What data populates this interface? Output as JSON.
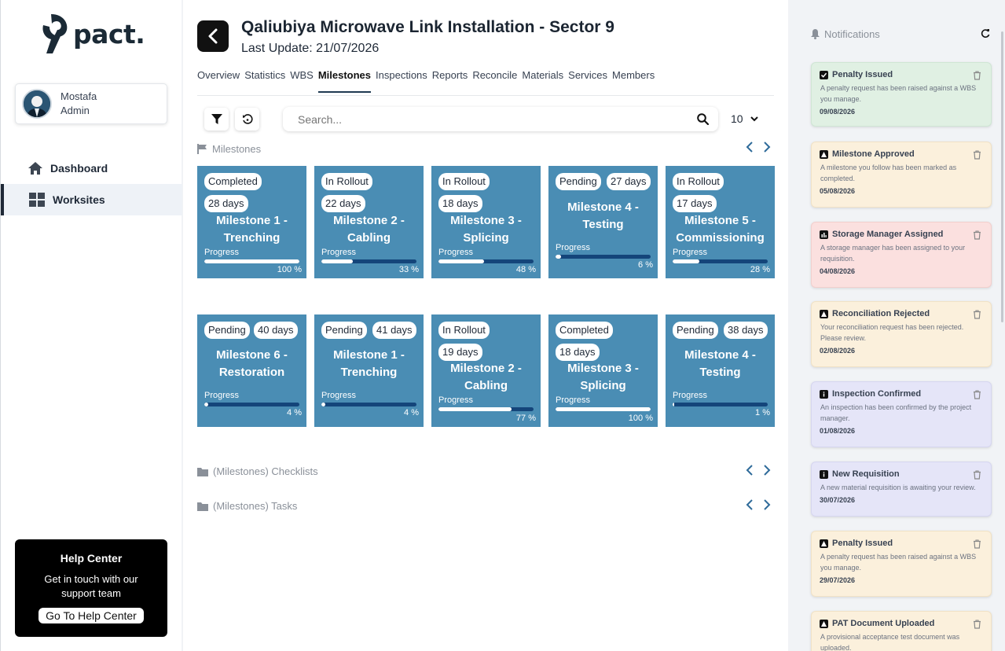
{
  "brand": {
    "name": "pact."
  },
  "user": {
    "name": "Mostafa",
    "role": "Admin"
  },
  "nav": [
    {
      "label": "Dashboard",
      "icon": "home-icon",
      "active": false
    },
    {
      "label": "Worksites",
      "icon": "grid-icon",
      "active": true
    }
  ],
  "help": {
    "title": "Help Center",
    "text": "Get in touch with our support team",
    "button": "Go To Help Center"
  },
  "header": {
    "title": "Qaliubiya Microwave Link Installation - Sector 9",
    "last_update": "Last Update: 21/07/2026"
  },
  "tabs": [
    "Overview",
    "Statistics",
    "WBS",
    "Milestones",
    "Inspections",
    "Reports",
    "Reconcile",
    "Materials",
    "Services",
    "Members"
  ],
  "active_tab": "Milestones",
  "search": {
    "placeholder": "Search..."
  },
  "page_size": "10",
  "sections": {
    "milestones": "Milestones",
    "checklists": "(Milestones) Checklists",
    "tasks": "(Milestones) Tasks"
  },
  "progress_label": "Progress",
  "colors": {
    "card": "#4a8db4",
    "bar_track": "#14457a",
    "accent": "#1f3a52"
  },
  "milestones": [
    {
      "status": "Completed",
      "days": "28 days",
      "title": "Milestone 1 - Trenching",
      "progress": 100,
      "pct": "100 %"
    },
    {
      "status": "In Rollout",
      "days": "22 days",
      "title": "Milestone 2 - Cabling",
      "progress": 33,
      "pct": "33 %"
    },
    {
      "status": "In Rollout",
      "days": "18 days",
      "title": "Milestone 3 - Splicing",
      "progress": 48,
      "pct": "48 %"
    },
    {
      "status": "Pending",
      "days": "27 days",
      "title": "Milestone 4 - Testing",
      "progress": 6,
      "pct": "6 %"
    },
    {
      "status": "In Rollout",
      "days": "17 days",
      "title": "Milestone 5 - Commissioning",
      "progress": 28,
      "pct": "28 %"
    },
    {
      "status": "Pending",
      "days": "40 days",
      "title": "Milestone 6 - Restoration",
      "progress": 4,
      "pct": "4 %"
    },
    {
      "status": "Pending",
      "days": "41 days",
      "title": "Milestone 1 - Trenching",
      "progress": 4,
      "pct": "4 %"
    },
    {
      "status": "In Rollout",
      "days": "19 days",
      "title": "Milestone 2 - Cabling",
      "progress": 77,
      "pct": "77 %"
    },
    {
      "status": "Completed",
      "days": "18 days",
      "title": "Milestone 3 - Splicing",
      "progress": 100,
      "pct": "100 %"
    },
    {
      "status": "Pending",
      "days": "38 days",
      "title": "Milestone 4 - Testing",
      "progress": 1,
      "pct": "1 %"
    }
  ],
  "notifications_title": "Notifications",
  "notifications": [
    {
      "title": "Penalty Issued",
      "icon": "check-icon",
      "body": "A penalty request has been raised against a WBS you manage.",
      "date": "09/08/2026",
      "color": "#e0f0e3",
      "border": "#cfe6d4"
    },
    {
      "title": "Milestone Approved",
      "icon": "warning-icon",
      "body": "A milestone you follow has been marked as completed.",
      "date": "05/08/2026",
      "color": "#fbf0dc",
      "border": "#f1e2c6"
    },
    {
      "title": "Storage Manager Assigned",
      "icon": "chart-icon",
      "body": "A storage manager has been assigned to your requisition.",
      "date": "04/08/2026",
      "color": "#fbe0df",
      "border": "#f2cfcd"
    },
    {
      "title": "Reconciliation Rejected",
      "icon": "warning-icon",
      "body": "Your reconciliation request has been rejected. Please review.",
      "date": "02/08/2026",
      "color": "#fbf0dc",
      "border": "#f1e2c6"
    },
    {
      "title": "Inspection Confirmed",
      "icon": "info-icon",
      "body": "An inspection has been confirmed by the project manager.",
      "date": "01/08/2026",
      "color": "#e5e5f8",
      "border": "#d6d6f0"
    },
    {
      "title": "New Requisition",
      "icon": "info-icon",
      "body": "A new material requisition is awaiting your review.",
      "date": "30/07/2026",
      "color": "#e5e5f8",
      "border": "#d6d6f0"
    },
    {
      "title": "Penalty Issued",
      "icon": "warning-icon",
      "body": "A penalty request has been raised against a WBS you manage.",
      "date": "29/07/2026",
      "color": "#fbf0dc",
      "border": "#f1e2c6"
    },
    {
      "title": "PAT Document Uploaded",
      "icon": "warning-icon",
      "body": "A provisional acceptance test document was uploaded.",
      "date": "",
      "color": "#fbf0dc",
      "border": "#f1e2c6"
    }
  ]
}
